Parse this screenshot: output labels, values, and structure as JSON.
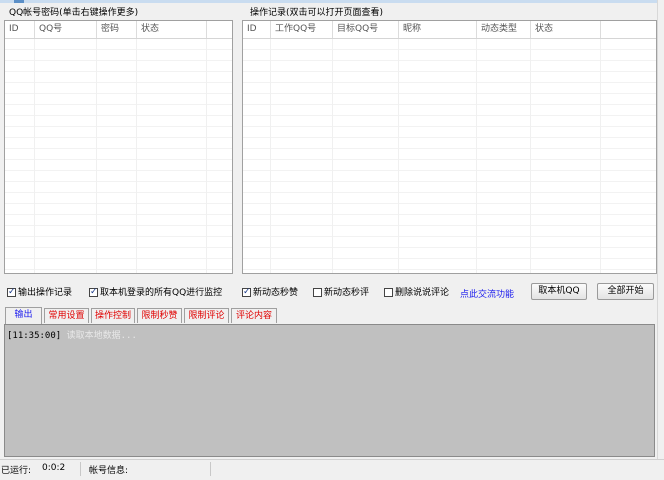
{
  "left_group": {
    "label": "QQ帐号密码(单击右键操作更多)",
    "columns": [
      "ID",
      "QQ号",
      "密码",
      "状态"
    ]
  },
  "right_group": {
    "label": "操作记录(双击可以打开页面查看)",
    "columns": [
      "ID",
      "工作QQ号",
      "目标QQ号",
      "昵称",
      "动态类型",
      "状态"
    ]
  },
  "options": {
    "output_log": {
      "label": "输出操作记录",
      "checked": true
    },
    "monitor_local": {
      "label": "取本机登录的所有QQ进行监控",
      "checked": true
    },
    "new_post_like": {
      "label": "新动态秒赞",
      "checked": true
    },
    "new_post_comment": {
      "label": "新动态秒评",
      "checked": false
    },
    "delete_comment": {
      "label": "删除说说评论",
      "checked": false
    }
  },
  "links": {
    "exchange": "点此交流功能"
  },
  "buttons": {
    "get_local_qq": "取本机QQ",
    "start_all": "全部开始"
  },
  "tabs": [
    {
      "label": "输出",
      "active": true
    },
    {
      "label": "常用设置",
      "active": false
    },
    {
      "label": "操作控制",
      "active": false
    },
    {
      "label": "限制秒赞",
      "active": false
    },
    {
      "label": "限制评论",
      "active": false
    },
    {
      "label": "评论内容",
      "active": false
    }
  ],
  "log": {
    "time": "[11:35:00]",
    "message": "读取本地数据..."
  },
  "status": {
    "runtime_label": "已运行:",
    "runtime_value": "0:0:2",
    "account_label": "帐号信息:"
  },
  "colors": {
    "tab_text": "#e00000",
    "active_tab_text": "#1a1aee",
    "link": "#1a1aee",
    "output_bg": "#c0c0c0"
  }
}
